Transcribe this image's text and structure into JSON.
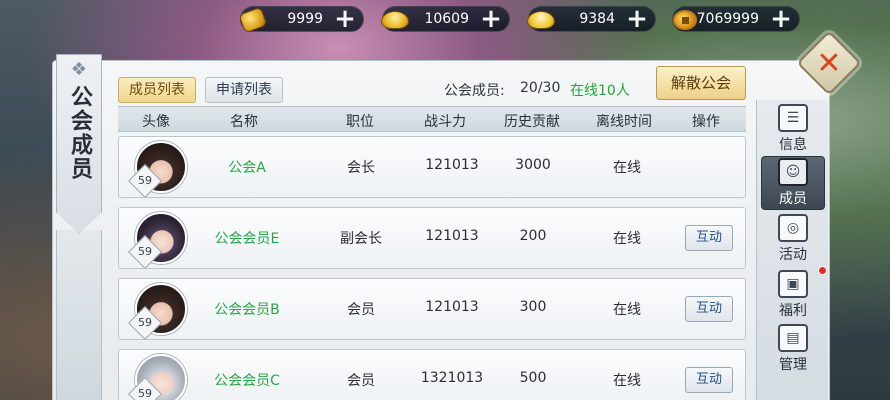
{
  "currencies": [
    {
      "icon": "coin-purse-icon",
      "value": "9999",
      "plus": "+"
    },
    {
      "icon": "gold-ingot-lock-icon",
      "value": "10609",
      "plus": "+"
    },
    {
      "icon": "gold-ingot-icon",
      "value": "9384",
      "plus": "+"
    },
    {
      "icon": "copper-coin-icon",
      "value": "7069999",
      "plus": "+"
    }
  ],
  "panel": {
    "title": "公会成员",
    "close": "✕"
  },
  "tabs": [
    {
      "label": "成员列表",
      "active": true
    },
    {
      "label": "申请列表",
      "active": false
    }
  ],
  "summary": {
    "members_label": "公会成员:",
    "members_value": "20/30",
    "online_value": "在线10人",
    "disband_label": "解散公会"
  },
  "table": {
    "headers": [
      "头像",
      "名称",
      "职位",
      "战斗力",
      "历史贡献",
      "离线时间",
      "操作"
    ],
    "rows": [
      {
        "level": "59",
        "name": "公会A",
        "position": "会长",
        "power": "121013",
        "contribution": "3000",
        "offline": "在线",
        "action": ""
      },
      {
        "level": "59",
        "name": "公会会员E",
        "position": "副会长",
        "power": "121013",
        "contribution": "200",
        "offline": "在线",
        "action": "互动"
      },
      {
        "level": "59",
        "name": "公会会员B",
        "position": "会员",
        "power": "121013",
        "contribution": "300",
        "offline": "在线",
        "action": "互动"
      },
      {
        "level": "59",
        "name": "公会会员C",
        "position": "会员",
        "power": "1321013",
        "contribution": "500",
        "offline": "在线",
        "action": "互动"
      }
    ]
  },
  "side_nav": [
    {
      "label": "信息",
      "icon": "scroll-icon",
      "active": false
    },
    {
      "label": "成员",
      "icon": "member-icon",
      "active": true
    },
    {
      "label": "活动",
      "icon": "activity-icon",
      "active": false
    },
    {
      "label": "福利",
      "icon": "gift-icon",
      "active": false
    },
    {
      "label": "管理",
      "icon": "manage-icon",
      "active": false
    }
  ]
}
